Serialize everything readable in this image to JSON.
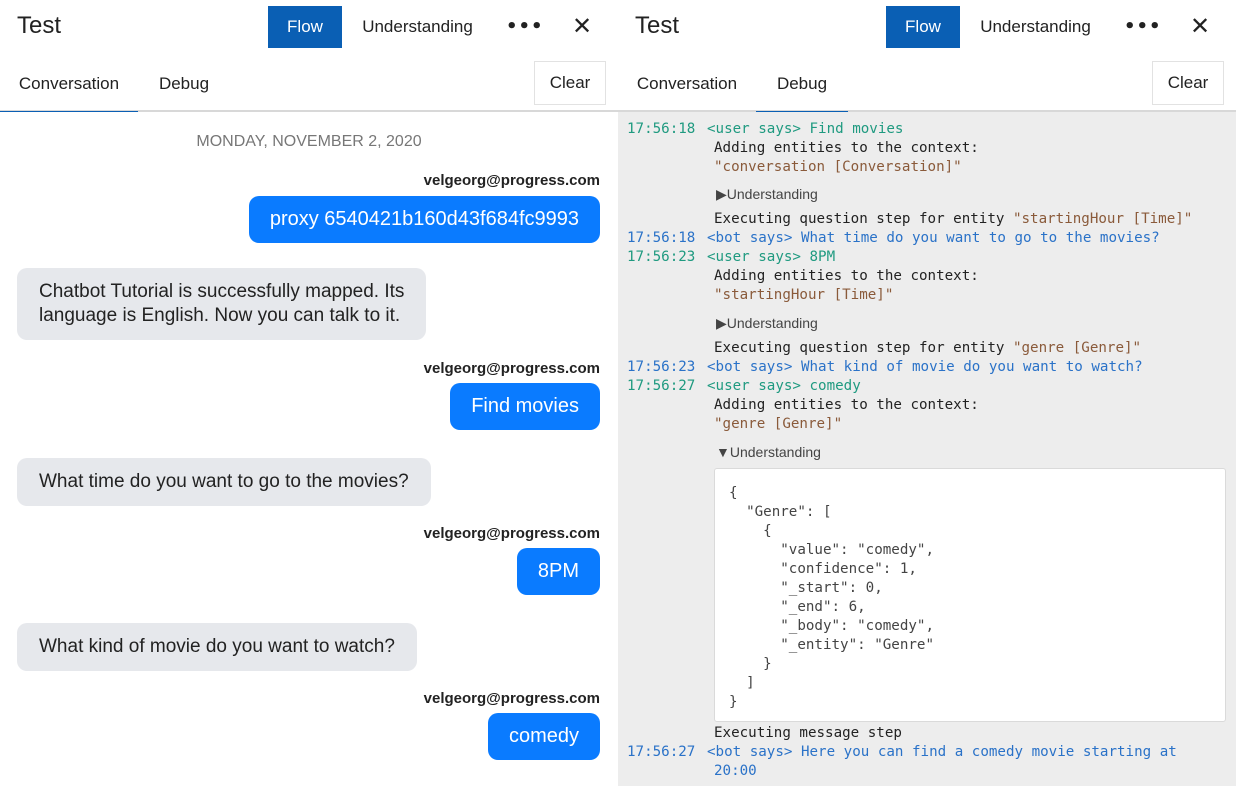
{
  "left": {
    "title": "Test",
    "flow_label": "Flow",
    "understanding_label": "Understanding",
    "more_label": "•••",
    "close_label": "✕",
    "tabs": [
      {
        "label": "Conversation"
      },
      {
        "label": "Debug"
      }
    ],
    "active_tab": "Conversation",
    "clear_label": "Clear"
  },
  "right": {
    "title": "Test",
    "flow_label": "Flow",
    "understanding_label": "Understanding",
    "more_label": "•••",
    "close_label": "✕",
    "tabs": [
      {
        "label": "Conversation"
      },
      {
        "label": "Debug"
      }
    ],
    "active_tab": "Debug",
    "clear_label": "Clear"
  },
  "conversation": {
    "date": "MONDAY, NOVEMBER 2, 2020",
    "messages": [
      {
        "sender": "velgeorg@progress.com",
        "text": "proxy 6540421b160d43f684fc9993"
      },
      {
        "text_line1": "Chatbot Tutorial is successfully mapped. Its",
        "text_line2": "language is English. Now you can talk to it."
      },
      {
        "sender": "velgeorg@progress.com",
        "text": "Find movies"
      },
      {
        "text": "What time do you want to go to the movies?"
      },
      {
        "sender": "velgeorg@progress.com",
        "text": "8PM"
      },
      {
        "text": "What kind of movie do you want to watch?"
      },
      {
        "sender": "velgeorg@progress.com",
        "text": "comedy"
      }
    ]
  },
  "debug": {
    "entries": [
      {
        "ts": "17:56:18",
        "text": "<user says> Find movies"
      },
      {
        "text": "Adding entities to the context:"
      },
      {
        "text": "\"conversation [Conversation]\""
      },
      {
        "toggle": "▶Understanding"
      },
      {
        "prefix": "Executing question step for entity ",
        "value": "\"startingHour [Time]\""
      },
      {
        "ts": "17:56:18",
        "text": "<bot says> What time do you want to go to the movies?"
      },
      {
        "ts": "17:56:23",
        "text": "<user says> 8PM"
      },
      {
        "text": "Adding entities to the context:"
      },
      {
        "text": "\"startingHour [Time]\""
      },
      {
        "toggle": "▶Understanding"
      },
      {
        "prefix": "Executing question step for entity ",
        "value": "\"genre [Genre]\""
      },
      {
        "ts": "17:56:23",
        "text": "<bot says> What kind of movie do you want to watch?"
      },
      {
        "ts": "17:56:27",
        "text": "<user says> comedy"
      },
      {
        "text": "Adding entities to the context:"
      },
      {
        "text": "\"genre [Genre]\""
      },
      {
        "toggle": "▼Understanding"
      },
      {
        "text": "Executing message step"
      },
      {
        "ts": "17:56:27",
        "text": "<bot says> Here you can find a comedy movie starting at",
        "text2": "20:00"
      }
    ],
    "json_lines": [
      "{",
      "  \"Genre\": [",
      "    {",
      "      \"value\": \"comedy\",",
      "      \"confidence\": 1,",
      "      \"_start\": 0,",
      "      \"_end\": 6,",
      "      \"_body\": \"comedy\",",
      "      \"_entity\": \"Genre\"",
      "    }",
      "  ]",
      "}"
    ]
  },
  "colors": {
    "primary": "#0a5fb4",
    "user_bubble": "#0a7bff",
    "bot_bubble": "#e6e8ec",
    "debug_bg": "#ededed",
    "ts_teal": "#1f9a80",
    "bot_blue": "#2a72c8"
  }
}
